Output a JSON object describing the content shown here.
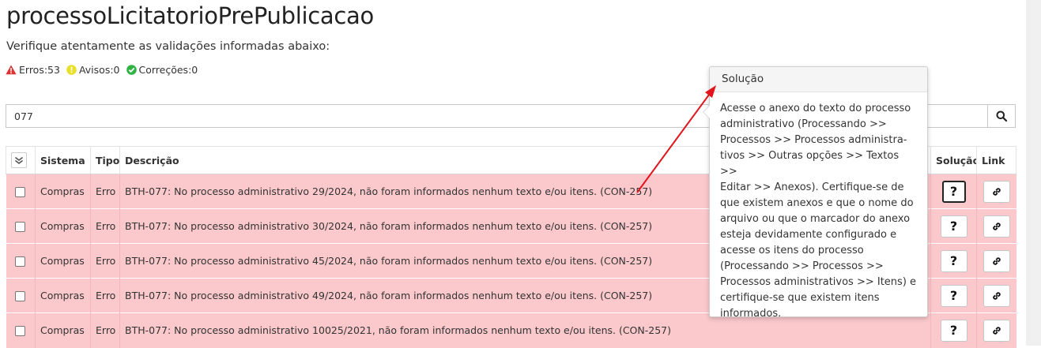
{
  "page": {
    "title": "processoLicitatorioPrePublicacao",
    "subtitle": "Verifique atentamente as validações informadas abaixo:"
  },
  "counters": {
    "errors": "Erros:53",
    "warnings": "Avisos:0",
    "corrections": "Correções:0"
  },
  "search": {
    "value": "077",
    "placeholder": ""
  },
  "table": {
    "headers": {
      "sistema": "Sistema",
      "tipo": "Tipo",
      "descricao": "Descrição",
      "solucao": "Solução",
      "link": "Link"
    },
    "rows": [
      {
        "sistema": "Compras",
        "tipo": "Erro",
        "descricao": "BTH-077: No processo administrativo 29/2024, não foram informados nenhum texto e/ou itens. (CON-257)"
      },
      {
        "sistema": "Compras",
        "tipo": "Erro",
        "descricao": "BTH-077: No processo administrativo 30/2024, não foram informados nenhum texto e/ou itens. (CON-257)"
      },
      {
        "sistema": "Compras",
        "tipo": "Erro",
        "descricao": "BTH-077: No processo administrativo 45/2024, não foram informados nenhum texto e/ou itens. (CON-257)"
      },
      {
        "sistema": "Compras",
        "tipo": "Erro",
        "descricao": "BTH-077: No processo administrativo 49/2024, não foram informados nenhum texto e/ou itens. (CON-257)"
      },
      {
        "sistema": "Compras",
        "tipo": "Erro",
        "descricao": "BTH-077: No processo administrativo 10025/2021, não foram informados nenhum texto e/ou itens. (CON-257)"
      }
    ],
    "solution_button": "?"
  },
  "popover": {
    "title": "Solução",
    "lines": [
      "Acesse o anexo do texto do processo",
      "administrativo (Processando >>",
      "Processos >> Processos administra-",
      "tivos >> Outras opções >> Textos >>",
      "Editar >> Anexos). Certifique-se de",
      "que existem anexos e que o nome do",
      "arquivo ou que o marcador do anexo",
      "esteja devidamente configurado e",
      "acesse os itens do processo",
      "(Processando >> Processos >>",
      "Processos administrativos >> Itens) e",
      "certifique-se que existem itens",
      "informados."
    ]
  },
  "colors": {
    "error_row": "#fbc9cc",
    "error_icon": "#e03131",
    "warning_icon": "#e8e02a",
    "correction_icon": "#2fb344",
    "annotation_arrow": "#e0161c"
  },
  "icons": [
    "error-icon",
    "warning-icon",
    "check-circle-icon",
    "search-icon",
    "double-check-icon",
    "link-icon",
    "question-icon"
  ]
}
